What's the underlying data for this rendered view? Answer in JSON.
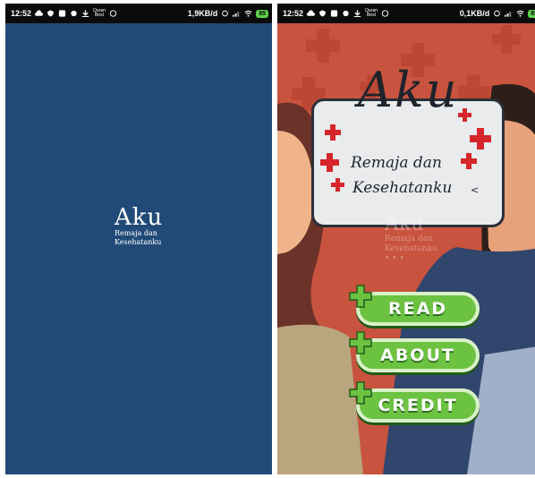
{
  "left_screen": {
    "status": {
      "time": "12:52",
      "quran_line1": "Quran",
      "quran_line2": "Best",
      "speed": "1,9KB/d",
      "battery": "85"
    },
    "logo": {
      "aku": "Aku",
      "line1": "Remaja dan",
      "line2": "Kesehatanku"
    }
  },
  "right_screen": {
    "status": {
      "time": "12:52",
      "quran_line1": "Quran",
      "quran_line2": "Best",
      "speed": "0,1KB/d",
      "battery": "85"
    },
    "logo": {
      "aku": "Aku",
      "line1": "Remaja dan",
      "line2": "Kesehatanku",
      "arrow": "<"
    },
    "ghost_logo": {
      "aku": "Aku",
      "line1": "Remaja dan",
      "line2": "Kesehatanku",
      "dots": "• • •"
    },
    "menu": {
      "read_label": "READ",
      "about_label": "ABOUT",
      "credit_label": "CREDIT"
    }
  },
  "colors": {
    "splash_bg": "#214a78",
    "poster_bg": "#c8533e",
    "button_green": "#6cc241",
    "cross_red": "#d7262b"
  }
}
